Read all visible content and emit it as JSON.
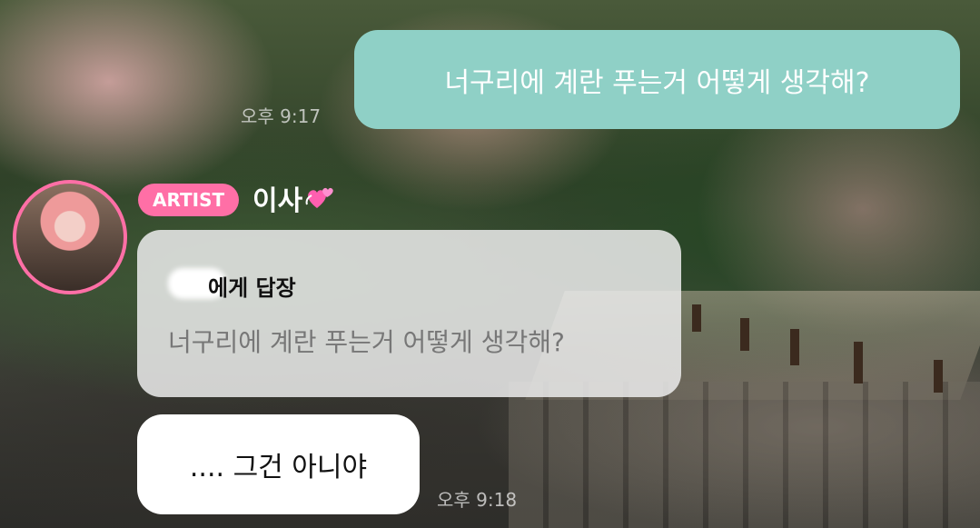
{
  "outgoing": {
    "message": "너구리에 계란 푸는거 어떻게 생각해?",
    "time": "오후 9:17"
  },
  "incoming": {
    "badge": "ARTIST",
    "sender_name": "이사",
    "sender_emoji_icon": "revolving-hearts-icon",
    "reply_header": "에게 답장",
    "reply_quote": "너구리에 계란 푸는거 어떻게 생각해?",
    "message": ".... 그건 아니야",
    "time": "오후 9:18"
  },
  "colors": {
    "outgoing_bubble": "#8fd0c6",
    "artist_badge": "#ff6fa6",
    "avatar_ring": "#ff6fa6"
  }
}
